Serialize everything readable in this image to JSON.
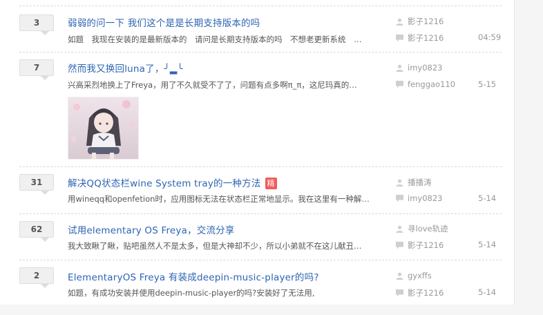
{
  "threads": [
    {
      "replies": "3",
      "title": "弱弱的问一下 我们这个是是长期支持版本的吗",
      "excerpt": "如题　我现在安装的是最新版本的　请问是长期支持版本的吗　不想老更新系统　…",
      "author": "影子1216",
      "last_replier": "影子1216",
      "time": "04:59",
      "badge": ""
    },
    {
      "replies": "7",
      "title": "然而我又换回luna了，╯▂╰",
      "excerpt": "兴高采烈地换上了Freya，用了不久就受不了了，问题有点多啊π_π，这尼玛真的…",
      "author": "imy0823",
      "last_replier": "fenggao110",
      "time": "5-15",
      "badge": ""
    },
    {
      "replies": "31",
      "title": "解决QQ状态栏wine System tray的一种方法",
      "excerpt": "用wineqq和openfetion时，应用图标无法在状态栏正常地显示。我在这里有一种解…",
      "author": "播播涛",
      "last_replier": "imy0823",
      "time": "5-14",
      "badge": "精"
    },
    {
      "replies": "62",
      "title": "试用elementary OS Freya，交流分享",
      "excerpt": "我大致瞅了瞅，贴吧虽然人不是太多，但是大神却不少，所以小弟就不在这儿献丑…",
      "author": "寻love轨迹",
      "last_replier": "影子1216",
      "time": "5-14",
      "badge": ""
    },
    {
      "replies": "2",
      "title": "ElementaryOS Freya 有装成deepin-music-player的吗?",
      "excerpt": "如题，有成功安装并使用deepin-music-player的吗?安装好了无法用,",
      "author": "gyxffs",
      "last_replier": "影子1216",
      "time": "5-14",
      "badge": ""
    }
  ],
  "icons": {
    "author": "person-icon",
    "last_reply": "speech-bubble-icon"
  },
  "colors": {
    "link": "#2d64b3",
    "badge": "#f15c5c",
    "muted": "#999999"
  }
}
